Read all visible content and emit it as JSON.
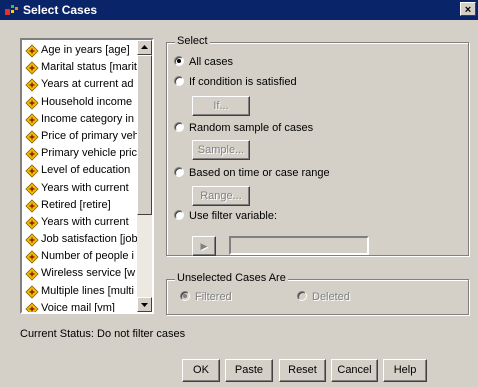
{
  "window": {
    "title": "Select Cases",
    "close_label": "×"
  },
  "variables": [
    "Age in years [age]",
    "Marital status [marit",
    "Years at current ad",
    "Household income",
    "Income category in",
    "Price of primary veh",
    "Primary vehicle pric",
    "Level of education",
    "Years with current",
    "Retired [retire]",
    "Years with current",
    "Job satisfaction [job",
    "Number of people i",
    "Wireless service [w",
    "Multiple lines [multi",
    "Voice mail [vm]"
  ],
  "select_group": {
    "legend": "Select",
    "options": [
      {
        "label": "All cases",
        "checked": true
      },
      {
        "label": "If condition is satisfied",
        "checked": false
      },
      {
        "label": "Random sample of cases",
        "checked": false
      },
      {
        "label": "Based on time or case range",
        "checked": false
      },
      {
        "label": "Use filter variable:",
        "checked": false
      }
    ],
    "if_button": "If...",
    "sample_button": "Sample...",
    "range_button": "Range...",
    "filter_arrow": "▶",
    "filter_value": ""
  },
  "unselected_group": {
    "legend": "Unselected Cases Are",
    "filtered_label": "Filtered",
    "deleted_label": "Deleted"
  },
  "status": "Current Status: Do not filter cases",
  "buttons": {
    "ok": "OK",
    "paste": "Paste",
    "reset": "Reset",
    "cancel": "Cancel",
    "help": "Help"
  }
}
